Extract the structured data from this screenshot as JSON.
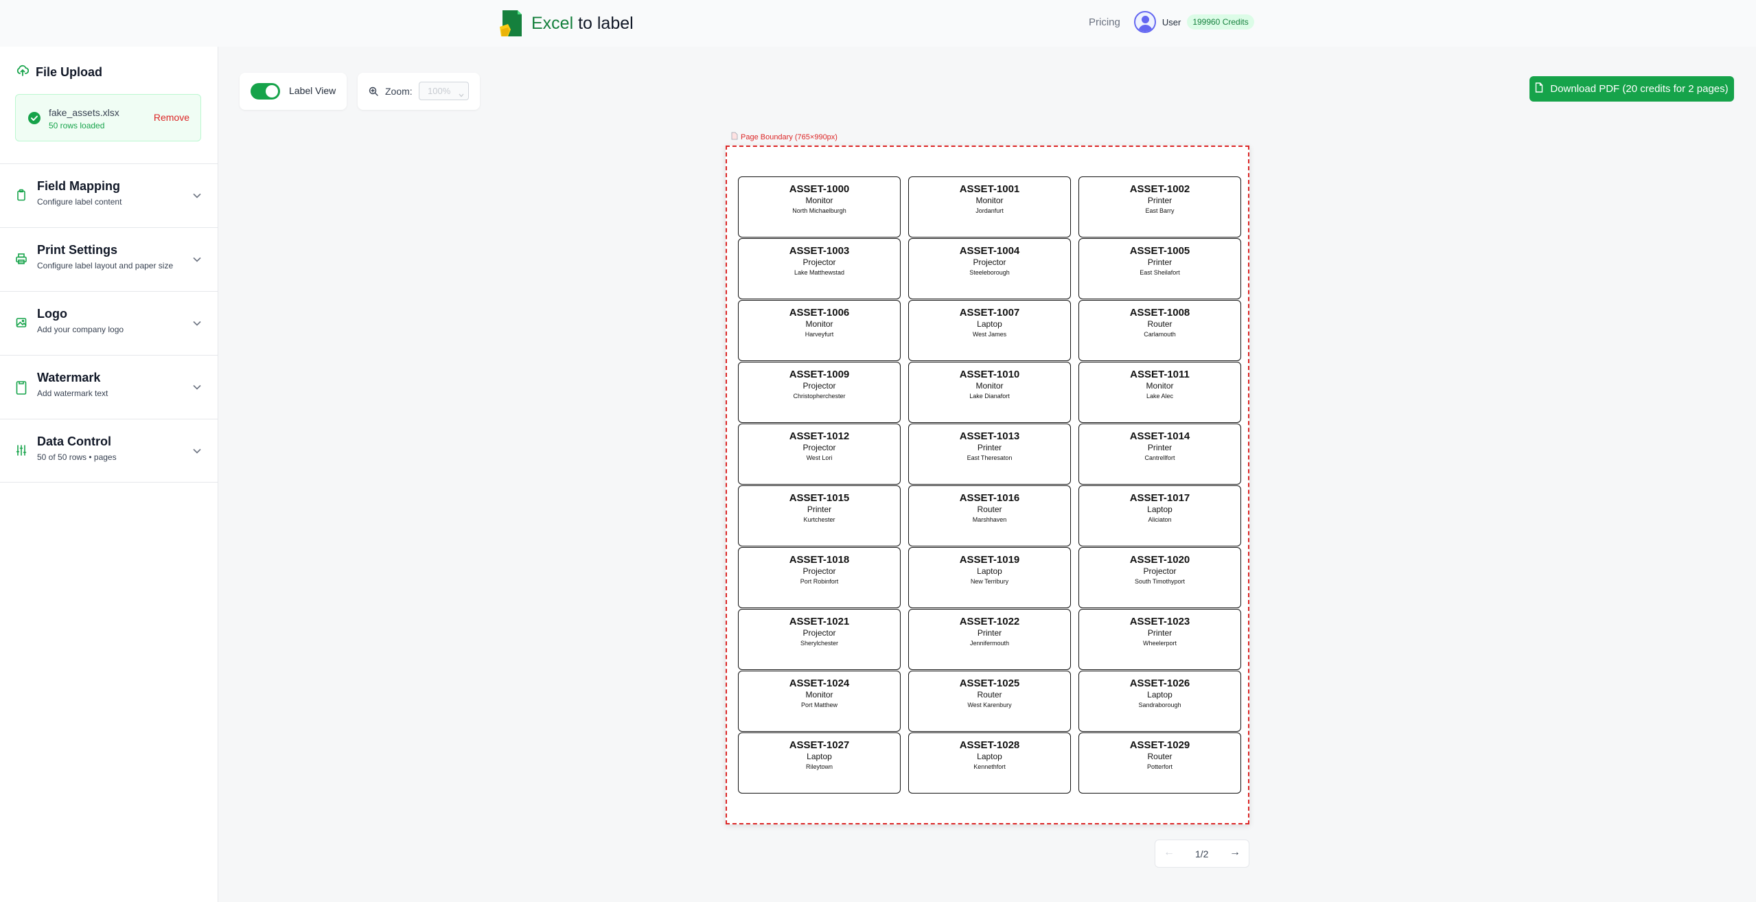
{
  "header": {
    "brand_accent": "Excel",
    "brand_rest": " to label",
    "pricing": "Pricing",
    "user": "User",
    "credits": "199960 Credits"
  },
  "sidebar": {
    "upload_title": "File Upload",
    "file_name": "fake_assets.xlsx",
    "file_rows": "50 rows loaded",
    "remove": "Remove",
    "sections": [
      {
        "title": "Field Mapping",
        "subtitle": "Configure label content",
        "icon": "clipboard-icon"
      },
      {
        "title": "Print Settings",
        "subtitle": "Configure label layout and paper size",
        "icon": "printer-icon"
      },
      {
        "title": "Logo",
        "subtitle": "Add your company logo",
        "icon": "image-icon"
      },
      {
        "title": "Watermark",
        "subtitle": "Add watermark text",
        "icon": "document-icon"
      },
      {
        "title": "Data Control",
        "subtitle": "50 of 50 rows • pages",
        "icon": "sliders-icon"
      }
    ]
  },
  "toolbar": {
    "label_view": "Label View",
    "label_view_on": true,
    "zoom_label": "Zoom:",
    "zoom_value": "100%",
    "download": "Download PDF (20 credits for 2 pages)"
  },
  "preview": {
    "boundary_label": "Page Boundary (765×990px)",
    "labels": [
      {
        "id": "ASSET-1000",
        "type": "Monitor",
        "location": "North Michaelburgh"
      },
      {
        "id": "ASSET-1001",
        "type": "Monitor",
        "location": "Jordanfurt"
      },
      {
        "id": "ASSET-1002",
        "type": "Printer",
        "location": "East Barry"
      },
      {
        "id": "ASSET-1003",
        "type": "Projector",
        "location": "Lake Matthewstad"
      },
      {
        "id": "ASSET-1004",
        "type": "Projector",
        "location": "Steeleborough"
      },
      {
        "id": "ASSET-1005",
        "type": "Printer",
        "location": "East Sheilafort"
      },
      {
        "id": "ASSET-1006",
        "type": "Monitor",
        "location": "Harveyfurt"
      },
      {
        "id": "ASSET-1007",
        "type": "Laptop",
        "location": "West James"
      },
      {
        "id": "ASSET-1008",
        "type": "Router",
        "location": "Carlamouth"
      },
      {
        "id": "ASSET-1009",
        "type": "Projector",
        "location": "Christopherchester"
      },
      {
        "id": "ASSET-1010",
        "type": "Monitor",
        "location": "Lake Dianafort"
      },
      {
        "id": "ASSET-1011",
        "type": "Monitor",
        "location": "Lake Alec"
      },
      {
        "id": "ASSET-1012",
        "type": "Projector",
        "location": "West Lori"
      },
      {
        "id": "ASSET-1013",
        "type": "Printer",
        "location": "East Theresaton"
      },
      {
        "id": "ASSET-1014",
        "type": "Printer",
        "location": "Cantrellfort"
      },
      {
        "id": "ASSET-1015",
        "type": "Printer",
        "location": "Kurtchester"
      },
      {
        "id": "ASSET-1016",
        "type": "Router",
        "location": "Marshhaven"
      },
      {
        "id": "ASSET-1017",
        "type": "Laptop",
        "location": "Aliciaton"
      },
      {
        "id": "ASSET-1018",
        "type": "Projector",
        "location": "Port Robinfort"
      },
      {
        "id": "ASSET-1019",
        "type": "Laptop",
        "location": "New Terribury"
      },
      {
        "id": "ASSET-1020",
        "type": "Projector",
        "location": "South Timothyport"
      },
      {
        "id": "ASSET-1021",
        "type": "Projector",
        "location": "Sherylchester"
      },
      {
        "id": "ASSET-1022",
        "type": "Printer",
        "location": "Jennifermouth"
      },
      {
        "id": "ASSET-1023",
        "type": "Printer",
        "location": "Wheelerport"
      },
      {
        "id": "ASSET-1024",
        "type": "Monitor",
        "location": "Port Matthew"
      },
      {
        "id": "ASSET-1025",
        "type": "Router",
        "location": "West Karenbury"
      },
      {
        "id": "ASSET-1026",
        "type": "Laptop",
        "location": "Sandraborough"
      },
      {
        "id": "ASSET-1027",
        "type": "Laptop",
        "location": "Rileytown"
      },
      {
        "id": "ASSET-1028",
        "type": "Laptop",
        "location": "Kennethfort"
      },
      {
        "id": "ASSET-1029",
        "type": "Router",
        "location": "Potterfort"
      }
    ]
  },
  "pager": {
    "prev": "←",
    "page": "1/2",
    "next": "→"
  },
  "colors": {
    "brand_green": "#16a34a",
    "boundary_red": "#dc2626",
    "credits_bg": "#dcfce7"
  }
}
